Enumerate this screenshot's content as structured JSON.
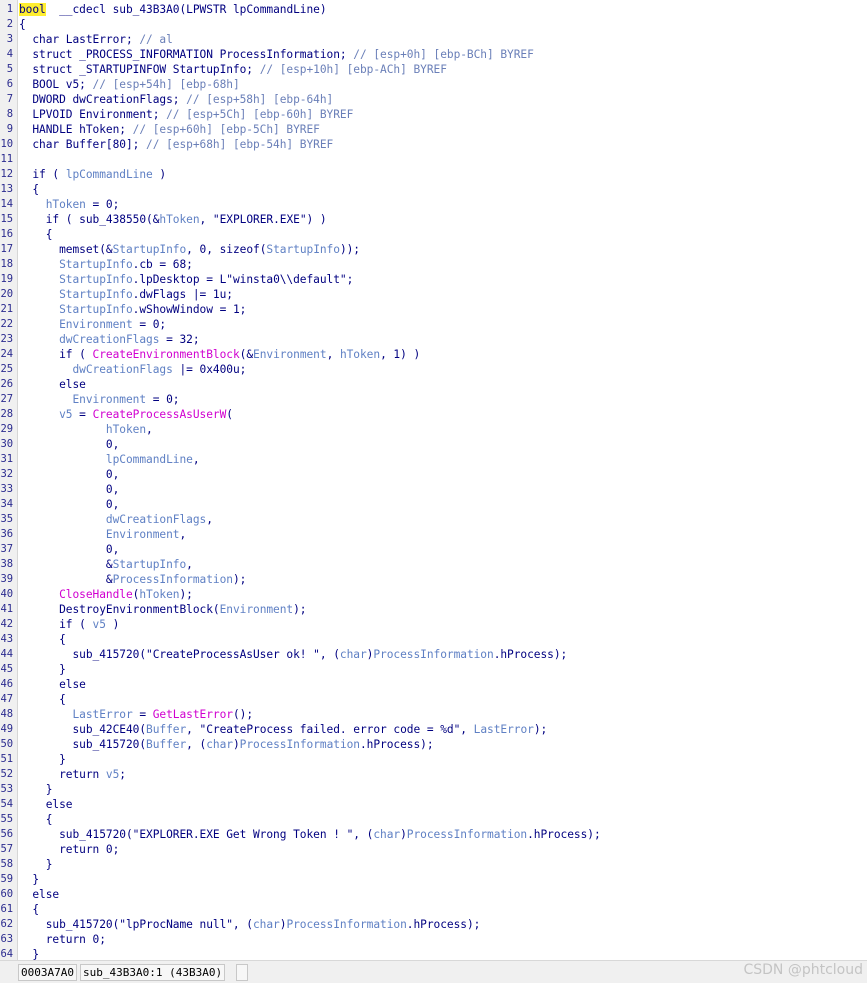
{
  "editor": {
    "lines": [
      {
        "n": "1",
        "t": [
          [
            "bool",
            "hl"
          ],
          [
            "  __cdecl sub_43B3A0(",
            "p"
          ],
          [
            "LPWSTR lpCommandLine",
            "p"
          ],
          [
            ")",
            "p"
          ]
        ]
      },
      {
        "n": "2",
        "t": [
          [
            "{",
            "p"
          ]
        ]
      },
      {
        "n": "3",
        "t": [
          [
            "  char LastError; ",
            "p"
          ],
          [
            "// al",
            "c"
          ]
        ]
      },
      {
        "n": "4",
        "t": [
          [
            "  struct _PROCESS_INFORMATION ProcessInformation; ",
            "p"
          ],
          [
            "// [esp+0h] [ebp-BCh] BYREF",
            "c"
          ]
        ]
      },
      {
        "n": "5",
        "t": [
          [
            "  struct _STARTUPINFOW StartupInfo; ",
            "p"
          ],
          [
            "// [esp+10h] [ebp-ACh] BYREF",
            "c"
          ]
        ]
      },
      {
        "n": "6",
        "t": [
          [
            "  BOOL v5; ",
            "p"
          ],
          [
            "// [esp+54h] [ebp-68h]",
            "c"
          ]
        ]
      },
      {
        "n": "7",
        "t": [
          [
            "  DWORD dwCreationFlags; ",
            "p"
          ],
          [
            "// [esp+58h] [ebp-64h]",
            "c"
          ]
        ]
      },
      {
        "n": "8",
        "t": [
          [
            "  LPVOID Environment; ",
            "p"
          ],
          [
            "// [esp+5Ch] [ebp-60h] BYREF",
            "c"
          ]
        ]
      },
      {
        "n": "9",
        "t": [
          [
            "  HANDLE hToken; ",
            "p"
          ],
          [
            "// [esp+60h] [ebp-5Ch] BYREF",
            "c"
          ]
        ]
      },
      {
        "n": "10",
        "t": [
          [
            "  char Buffer[80]; ",
            "p"
          ],
          [
            "// [esp+68h] [ebp-54h] BYREF",
            "c"
          ]
        ]
      },
      {
        "n": "11",
        "t": [
          [
            "",
            "p"
          ]
        ]
      },
      {
        "n": "12",
        "t": [
          [
            "  if ( ",
            "p"
          ],
          [
            "lpCommandLine",
            "v"
          ],
          [
            " )",
            "p"
          ]
        ]
      },
      {
        "n": "13",
        "t": [
          [
            "  {",
            "p"
          ]
        ]
      },
      {
        "n": "14",
        "t": [
          [
            "    ",
            "p"
          ],
          [
            "hToken",
            "v"
          ],
          [
            " = 0;",
            "p"
          ]
        ]
      },
      {
        "n": "15",
        "t": [
          [
            "    if ( sub_438550(&",
            "p"
          ],
          [
            "hToken",
            "v"
          ],
          [
            ", \"EXPLORER.EXE\") )",
            "p"
          ]
        ]
      },
      {
        "n": "16",
        "t": [
          [
            "    {",
            "p"
          ]
        ]
      },
      {
        "n": "17",
        "t": [
          [
            "      memset(&",
            "p"
          ],
          [
            "StartupInfo",
            "v"
          ],
          [
            ", 0, sizeof(",
            "p"
          ],
          [
            "StartupInfo",
            "v"
          ],
          [
            "));",
            "p"
          ]
        ]
      },
      {
        "n": "18",
        "t": [
          [
            "      ",
            "p"
          ],
          [
            "StartupInfo",
            "v"
          ],
          [
            ".cb = 68;",
            "p"
          ]
        ]
      },
      {
        "n": "19",
        "t": [
          [
            "      ",
            "p"
          ],
          [
            "StartupInfo",
            "v"
          ],
          [
            ".lpDesktop = L\"winsta0\\\\default\";",
            "p"
          ]
        ]
      },
      {
        "n": "20",
        "t": [
          [
            "      ",
            "p"
          ],
          [
            "StartupInfo",
            "v"
          ],
          [
            ".dwFlags |= 1u;",
            "p"
          ]
        ]
      },
      {
        "n": "21",
        "t": [
          [
            "      ",
            "p"
          ],
          [
            "StartupInfo",
            "v"
          ],
          [
            ".wShowWindow = 1;",
            "p"
          ]
        ]
      },
      {
        "n": "22",
        "t": [
          [
            "      ",
            "p"
          ],
          [
            "Environment",
            "v"
          ],
          [
            " = 0;",
            "p"
          ]
        ]
      },
      {
        "n": "23",
        "t": [
          [
            "      ",
            "p"
          ],
          [
            "dwCreationFlags",
            "v"
          ],
          [
            " = 32;",
            "p"
          ]
        ]
      },
      {
        "n": "24",
        "t": [
          [
            "      if ( ",
            "p"
          ],
          [
            "CreateEnvironmentBlock",
            "f"
          ],
          [
            "(&",
            "p"
          ],
          [
            "Environment",
            "v"
          ],
          [
            ", ",
            "p"
          ],
          [
            "hToken",
            "v"
          ],
          [
            ", 1) )",
            "p"
          ]
        ]
      },
      {
        "n": "25",
        "t": [
          [
            "        ",
            "p"
          ],
          [
            "dwCreationFlags",
            "v"
          ],
          [
            " |= 0x400u;",
            "p"
          ]
        ]
      },
      {
        "n": "26",
        "t": [
          [
            "      else",
            "p"
          ]
        ]
      },
      {
        "n": "27",
        "t": [
          [
            "        ",
            "p"
          ],
          [
            "Environment",
            "v"
          ],
          [
            " = 0;",
            "p"
          ]
        ]
      },
      {
        "n": "28",
        "t": [
          [
            "      ",
            "p"
          ],
          [
            "v5",
            "v"
          ],
          [
            " = ",
            "p"
          ],
          [
            "CreateProcessAsUserW",
            "f"
          ],
          [
            "(",
            "p"
          ]
        ]
      },
      {
        "n": "29",
        "t": [
          [
            "             ",
            "p"
          ],
          [
            "hToken",
            "v"
          ],
          [
            ",",
            "p"
          ]
        ]
      },
      {
        "n": "30",
        "t": [
          [
            "             0,",
            "p"
          ]
        ]
      },
      {
        "n": "31",
        "t": [
          [
            "             ",
            "p"
          ],
          [
            "lpCommandLine",
            "v"
          ],
          [
            ",",
            "p"
          ]
        ]
      },
      {
        "n": "32",
        "t": [
          [
            "             0,",
            "p"
          ]
        ]
      },
      {
        "n": "33",
        "t": [
          [
            "             0,",
            "p"
          ]
        ]
      },
      {
        "n": "34",
        "t": [
          [
            "             0,",
            "p"
          ]
        ]
      },
      {
        "n": "35",
        "t": [
          [
            "             ",
            "p"
          ],
          [
            "dwCreationFlags",
            "v"
          ],
          [
            ",",
            "p"
          ]
        ]
      },
      {
        "n": "36",
        "t": [
          [
            "             ",
            "p"
          ],
          [
            "Environment",
            "v"
          ],
          [
            ",",
            "p"
          ]
        ]
      },
      {
        "n": "37",
        "t": [
          [
            "             0,",
            "p"
          ]
        ]
      },
      {
        "n": "38",
        "t": [
          [
            "             &",
            "p"
          ],
          [
            "StartupInfo",
            "v"
          ],
          [
            ",",
            "p"
          ]
        ]
      },
      {
        "n": "39",
        "t": [
          [
            "             &",
            "p"
          ],
          [
            "ProcessInformation",
            "v"
          ],
          [
            ");",
            "p"
          ]
        ]
      },
      {
        "n": "40",
        "t": [
          [
            "      ",
            "p"
          ],
          [
            "CloseHandle",
            "f"
          ],
          [
            "(",
            "p"
          ],
          [
            "hToken",
            "v"
          ],
          [
            ");",
            "p"
          ]
        ]
      },
      {
        "n": "41",
        "t": [
          [
            "      DestroyEnvironmentBlock(",
            "p"
          ],
          [
            "Environment",
            "v"
          ],
          [
            ");",
            "p"
          ]
        ]
      },
      {
        "n": "42",
        "t": [
          [
            "      if ( ",
            "p"
          ],
          [
            "v5",
            "v"
          ],
          [
            " )",
            "p"
          ]
        ]
      },
      {
        "n": "43",
        "t": [
          [
            "      {",
            "p"
          ]
        ]
      },
      {
        "n": "44",
        "t": [
          [
            "        sub_415720(\"CreateProcessAsUser ok! \", (",
            "p"
          ],
          [
            "char",
            "v"
          ],
          [
            ")",
            "p"
          ],
          [
            "ProcessInformation",
            "v"
          ],
          [
            ".hProcess);",
            "p"
          ]
        ]
      },
      {
        "n": "45",
        "t": [
          [
            "      }",
            "p"
          ]
        ]
      },
      {
        "n": "46",
        "t": [
          [
            "      else",
            "p"
          ]
        ]
      },
      {
        "n": "47",
        "t": [
          [
            "      {",
            "p"
          ]
        ]
      },
      {
        "n": "48",
        "t": [
          [
            "        ",
            "p"
          ],
          [
            "LastError",
            "v"
          ],
          [
            " = ",
            "p"
          ],
          [
            "GetLastError",
            "f"
          ],
          [
            "();",
            "p"
          ]
        ]
      },
      {
        "n": "49",
        "t": [
          [
            "        sub_42CE40(",
            "p"
          ],
          [
            "Buffer",
            "v"
          ],
          [
            ", \"CreateProcess failed. error code = %d\", ",
            "p"
          ],
          [
            "LastError",
            "v"
          ],
          [
            ");",
            "p"
          ]
        ]
      },
      {
        "n": "50",
        "t": [
          [
            "        sub_415720(",
            "p"
          ],
          [
            "Buffer",
            "v"
          ],
          [
            ", (",
            "p"
          ],
          [
            "char",
            "v"
          ],
          [
            ")",
            "p"
          ],
          [
            "ProcessInformation",
            "v"
          ],
          [
            ".hProcess);",
            "p"
          ]
        ]
      },
      {
        "n": "51",
        "t": [
          [
            "      }",
            "p"
          ]
        ]
      },
      {
        "n": "52",
        "t": [
          [
            "      return ",
            "p"
          ],
          [
            "v5",
            "v"
          ],
          [
            ";",
            "p"
          ]
        ]
      },
      {
        "n": "53",
        "t": [
          [
            "    }",
            "p"
          ]
        ]
      },
      {
        "n": "54",
        "t": [
          [
            "    else",
            "p"
          ]
        ]
      },
      {
        "n": "55",
        "t": [
          [
            "    {",
            "p"
          ]
        ]
      },
      {
        "n": "56",
        "t": [
          [
            "      sub_415720(\"EXPLORER.EXE Get Wrong Token ! \", (",
            "p"
          ],
          [
            "char",
            "v"
          ],
          [
            ")",
            "p"
          ],
          [
            "ProcessInformation",
            "v"
          ],
          [
            ".hProcess);",
            "p"
          ]
        ]
      },
      {
        "n": "57",
        "t": [
          [
            "      return 0;",
            "p"
          ]
        ]
      },
      {
        "n": "58",
        "t": [
          [
            "    }",
            "p"
          ]
        ]
      },
      {
        "n": "59",
        "t": [
          [
            "  }",
            "p"
          ]
        ]
      },
      {
        "n": "60",
        "t": [
          [
            "  else",
            "p"
          ]
        ]
      },
      {
        "n": "61",
        "t": [
          [
            "  {",
            "p"
          ]
        ]
      },
      {
        "n": "62",
        "t": [
          [
            "    sub_415720(\"lpProcName null\", (",
            "p"
          ],
          [
            "char",
            "v"
          ],
          [
            ")",
            "p"
          ],
          [
            "ProcessInformation",
            "v"
          ],
          [
            ".hProcess);",
            "p"
          ]
        ]
      },
      {
        "n": "63",
        "t": [
          [
            "    return 0;",
            "p"
          ]
        ]
      },
      {
        "n": "64",
        "t": [
          [
            "  }",
            "p"
          ]
        ]
      }
    ]
  },
  "status": {
    "address": "0003A7A0",
    "location": "sub_43B3A0:1 (43B3A0)",
    "blank": ""
  },
  "watermark": "CSDN @phtcloud",
  "colors": {
    "plain": "#000080",
    "variable": "#5f80c4",
    "comment": "#6a7fb8",
    "function": "#d000d0",
    "highlight": "#ffee30"
  }
}
